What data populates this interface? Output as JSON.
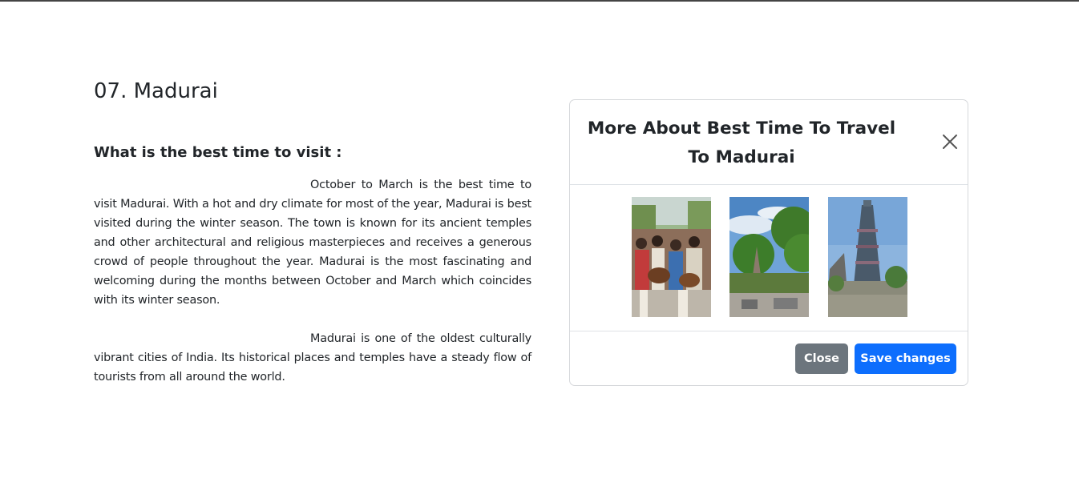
{
  "page": {
    "title": "07. Madurai",
    "subtitle": "What is the best time to visit :",
    "paragraphs": [
      "October to March is the best time to visit Madurai. With a hot and dry climate for most of the year, Madurai is best visited during the winter season. The town is known for its ancient temples and other architectural and religious masterpieces and receives a generous crowd of people throughout the year. Madurai is the most fascinating and welcoming during the months between October and March which coincides with its winter season.",
      "Madurai is one of the oldest culturally vibrant cities of India. Its historical places and temples have a steady flow of tourists from all around the world."
    ]
  },
  "modal": {
    "title": "More About Best Time To Travel To Madurai",
    "close_icon": "close-icon",
    "photos": [
      "festival-crowd-photo",
      "temple-trees-photo",
      "temple-gopuram-photo"
    ],
    "close_label": "Close",
    "save_label": "Save changes",
    "colors": {
      "close_button": "#6c757d",
      "save_button": "#0d6efd"
    }
  }
}
